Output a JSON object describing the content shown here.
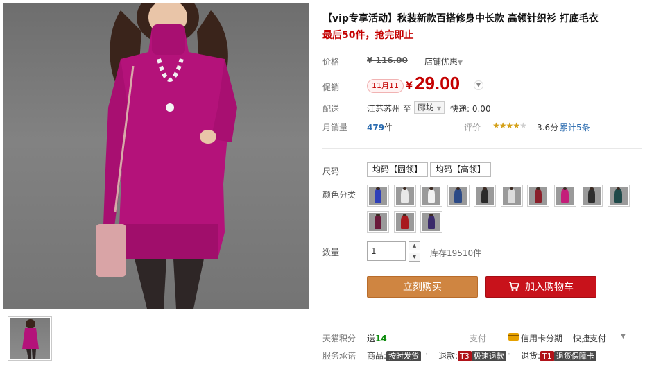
{
  "product": {
    "title": "【vip专享活动】秋装新款百搭修身中长款 高领针织衫 打底毛衣",
    "promo": "最后50件，抢完即止"
  },
  "price": {
    "label": "价格",
    "original": "¥ 116.00",
    "store_discount": "店铺优惠",
    "promo_label": "促销",
    "date_badge": "11月11",
    "currency": "¥",
    "current": "29.00"
  },
  "shipping": {
    "label": "配送",
    "from": "江苏苏州 至",
    "to": "廊坊",
    "fee": "快递: 0.00"
  },
  "sales": {
    "label": "月销量",
    "count": "479",
    "unit": "件",
    "rating_label": "评价",
    "rating_value": 3.6,
    "score": "3.6分",
    "reviews": "累计5条"
  },
  "options": {
    "size_label": "尺码",
    "sizes": [
      "均码【圆领】",
      "均码【高领】"
    ],
    "color_label": "颜色分类",
    "colors": [
      {
        "name": "blue",
        "hex": "#2e3fb8"
      },
      {
        "name": "white",
        "hex": "#e8e8e8"
      },
      {
        "name": "white-2",
        "hex": "#f2f2f2"
      },
      {
        "name": "navy",
        "hex": "#2c4a86"
      },
      {
        "name": "black",
        "hex": "#2a2a2a"
      },
      {
        "name": "grey-white",
        "hex": "#dcdcdc"
      },
      {
        "name": "wine",
        "hex": "#8a1f2a"
      },
      {
        "name": "rose",
        "hex": "#c41f7a"
      },
      {
        "name": "dark",
        "hex": "#2e2e2e"
      },
      {
        "name": "teal",
        "hex": "#1f4a4a"
      },
      {
        "name": "plum",
        "hex": "#6a1a3a"
      },
      {
        "name": "red",
        "hex": "#a8191e"
      },
      {
        "name": "purple",
        "hex": "#3a2a6a"
      }
    ]
  },
  "quantity": {
    "label": "数量",
    "value": "1",
    "stock": "库存19510件"
  },
  "actions": {
    "buy_now": "立刻购买",
    "add_to_cart": "加入购物车"
  },
  "footer": {
    "points_label": "天猫积分",
    "points_prefix": "送",
    "points_value": "14",
    "pay_label": "支付",
    "pay_credit": "信用卡分期",
    "pay_quick": "快捷支付",
    "service_label": "服务承诺",
    "services": [
      {
        "prefix": "商品:",
        "tag": "按时发货",
        "code": ""
      },
      {
        "prefix": "退款:",
        "tag": "极速退款",
        "code": "T3"
      },
      {
        "prefix": "退货:",
        "tag": "退货保障卡",
        "code": "T1"
      }
    ]
  },
  "colors": {
    "price_red": "#c40000",
    "buy_button": "#cf8541",
    "cart_button": "#c8121b",
    "sweater": "#b4127a"
  }
}
